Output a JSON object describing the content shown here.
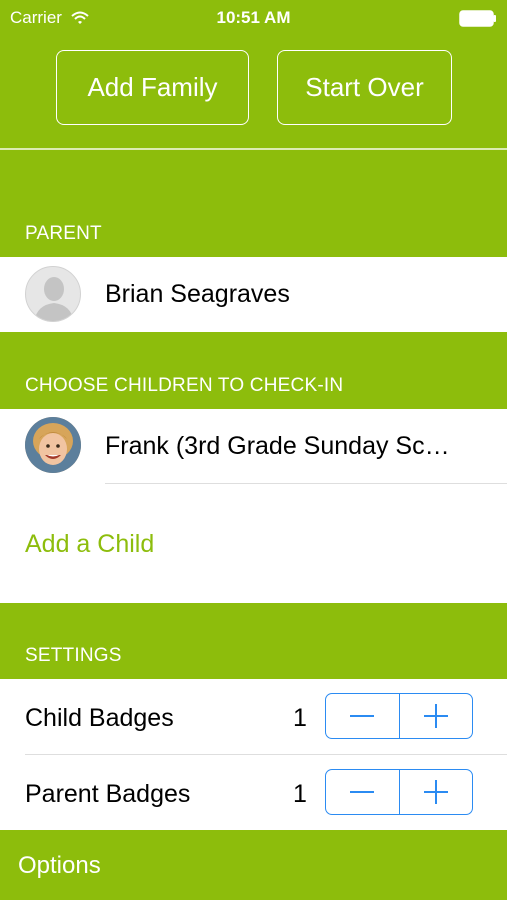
{
  "status_bar": {
    "carrier": "Carrier",
    "time": "10:51 AM"
  },
  "header": {
    "add_family_label": "Add Family",
    "start_over_label": "Start Over"
  },
  "parent_section": {
    "title": "PARENT",
    "parent_name": "Brian Seagraves"
  },
  "children_section": {
    "title": "CHOOSE CHILDREN TO CHECK-IN",
    "children": [
      {
        "label": "Frank (3rd Grade Sunday Sc…"
      }
    ],
    "add_child_label": "Add a Child"
  },
  "settings_section": {
    "title": "SETTINGS",
    "rows": [
      {
        "label": "Child Badges",
        "value": "1"
      },
      {
        "label": "Parent Badges",
        "value": "1"
      }
    ]
  },
  "footer": {
    "options_label": "Options"
  },
  "colors": {
    "accent": "#8dbd0c",
    "stepper": "#2b8bf2"
  }
}
